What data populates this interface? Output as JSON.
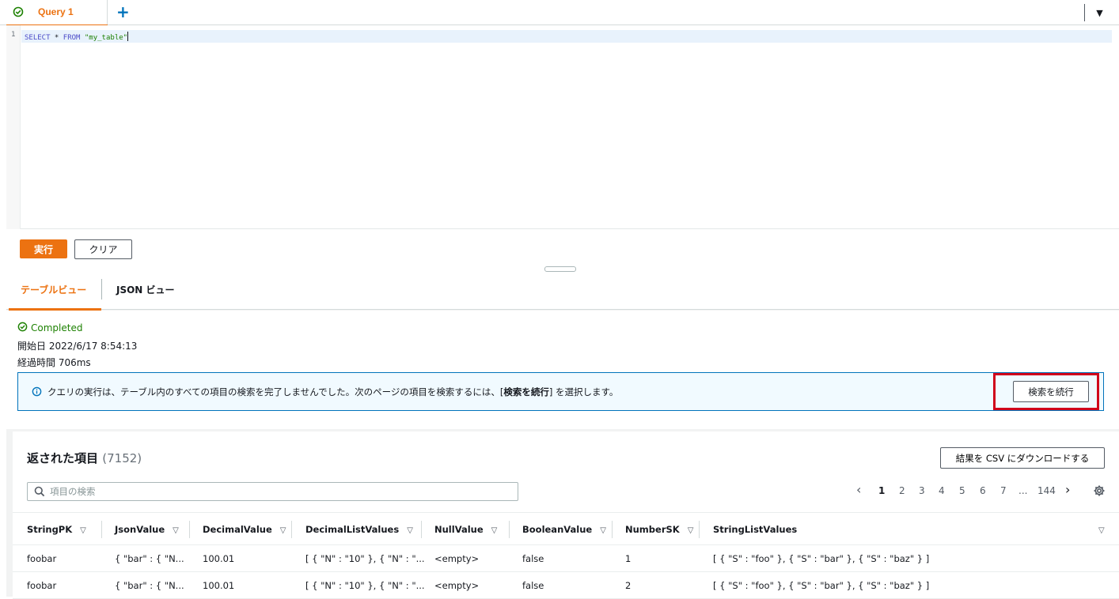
{
  "query_tabs": {
    "active_label": "Query 1",
    "add_label": "+",
    "menu_label": "▼"
  },
  "editor": {
    "line_number": "1",
    "sql": {
      "select_kw": "SELECT",
      "star": " * ",
      "from_kw": "FROM",
      "table": " \"my_table\""
    }
  },
  "actions": {
    "run_label": "実行",
    "clear_label": "クリア"
  },
  "result_tabs": {
    "table_view": "テーブルビュー",
    "json_view": "JSON ビュー"
  },
  "status": {
    "state": "Completed",
    "started": "開始日 2022/6/17 8:54:13",
    "elapsed": "経過時間 706ms"
  },
  "info": {
    "text_before": "クエリの実行は、テーブル内のすべての項目の検索を完了しませんでした。次のページの項目を検索するには、[",
    "text_bold": "検索を続行",
    "text_after": "] を選択します。",
    "continue_label": "検索を続行"
  },
  "results": {
    "title": "返された項目",
    "count": "(7152)",
    "download_label": "結果を CSV にダウンロードする",
    "search_placeholder": "項目の検索",
    "pagination": {
      "prev": "‹",
      "pages": [
        "1",
        "2",
        "3",
        "4",
        "5",
        "6",
        "7"
      ],
      "ellipsis": "...",
      "last": "144",
      "next": "›",
      "current": "1"
    },
    "columns": [
      "StringPK",
      "JsonValue",
      "DecimalValue",
      "DecimalListValues",
      "NullValue",
      "BooleanValue",
      "NumberSK",
      "StringListValues"
    ],
    "rows": [
      [
        "foobar",
        "{ \"bar\" : { \"N...",
        "100.01",
        "[ { \"N\" : \"10\" }, { \"N\" : \"...",
        "<empty>",
        "false",
        "1",
        "[ { \"S\" : \"foo\" }, { \"S\" : \"bar\" }, { \"S\" : \"baz\" } ]"
      ],
      [
        "foobar",
        "{ \"bar\" : { \"N...",
        "100.01",
        "[ { \"N\" : \"10\" }, { \"N\" : \"...",
        "<empty>",
        "false",
        "2",
        "[ { \"S\" : \"foo\" }, { \"S\" : \"bar\" }, { \"S\" : \"baz\" } ]"
      ]
    ]
  }
}
